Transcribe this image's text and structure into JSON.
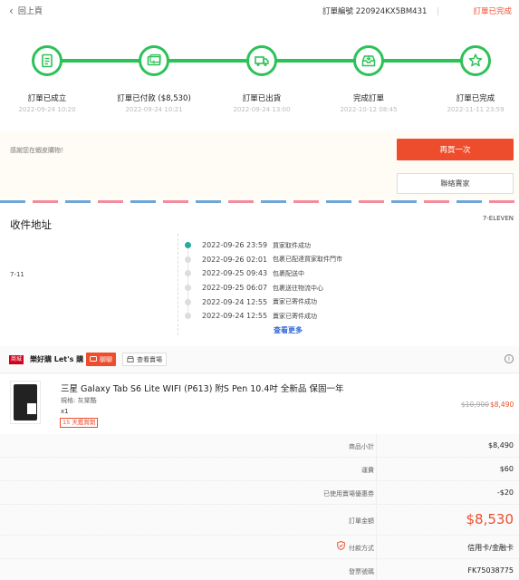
{
  "header": {
    "back_label": "回上頁",
    "order_id_label": "訂單編號",
    "order_id": "220924KX5BM431",
    "separator": "|",
    "status": "訂單已完成"
  },
  "colors": {
    "accent": "#ee4d2d",
    "progress": "#2dc258",
    "tracking_active": "#26aa99",
    "link": "#2e64d8"
  },
  "steps": [
    {
      "label": "訂單已成立",
      "time": "2022-09-24 10:20",
      "icon": "receipt-icon"
    },
    {
      "label": "訂單已付款 ($8,530)",
      "time": "2022-09-24 10:21",
      "icon": "payment-icon"
    },
    {
      "label": "訂單已出貨",
      "time": "2022-09-24 13:00",
      "icon": "truck-icon"
    },
    {
      "label": "完成訂單",
      "time": "2022-10-12 08:45",
      "icon": "inbox-icon"
    },
    {
      "label": "訂單已完成",
      "time": "2022-11-11 23:59",
      "icon": "star-icon"
    }
  ],
  "thanks": {
    "text": "感謝您在蝦皮購物！",
    "buy_again": "再買一次",
    "contact_seller": "聯絡賣家"
  },
  "address": {
    "title": "收件地址",
    "carrier": "7-ELEVEN",
    "store": "7-11",
    "tracking": [
      {
        "time": "2022-09-26 23:59",
        "desc": "買家取件成功",
        "active": true
      },
      {
        "time": "2022-09-26 02:01",
        "desc": "包裹已配達買家取件門市",
        "active": false
      },
      {
        "time": "2022-09-25 09:43",
        "desc": "包裹配送中",
        "active": false
      },
      {
        "time": "2022-09-25 06:07",
        "desc": "包裹送往物流中心",
        "active": false
      },
      {
        "time": "2022-09-24 12:55",
        "desc": "賣家已寄件成功",
        "active": false
      },
      {
        "time": "2022-09-24 12:55",
        "desc": "賣家已寄件成功",
        "active": false
      }
    ],
    "more": "查看更多"
  },
  "shop": {
    "badge": "商城",
    "name": "樂好購 Let's 購",
    "chat": "聊聊",
    "view_shop": "查看賣場"
  },
  "item": {
    "title": "三星 Galaxy Tab S6 Lite WIFI (P613) 附S Pen 10.4吋 全新品 保固一年",
    "spec": "規格: 灰棠酷",
    "qty": "x1",
    "return": "15 天鑑賞期",
    "price_old": "$10,900",
    "price_new": "$8,490"
  },
  "summary": [
    {
      "label": "商品小計",
      "value": "$8,490"
    },
    {
      "label": "運費",
      "value": "$60"
    },
    {
      "label": "已使用賣場優惠券",
      "value": "-$20"
    },
    {
      "label": "訂單金額",
      "value": "$8,530"
    },
    {
      "label": "付款方式",
      "value": "信用卡/金融卡"
    },
    {
      "label": "發票號碼",
      "value": "FK75038775"
    }
  ]
}
